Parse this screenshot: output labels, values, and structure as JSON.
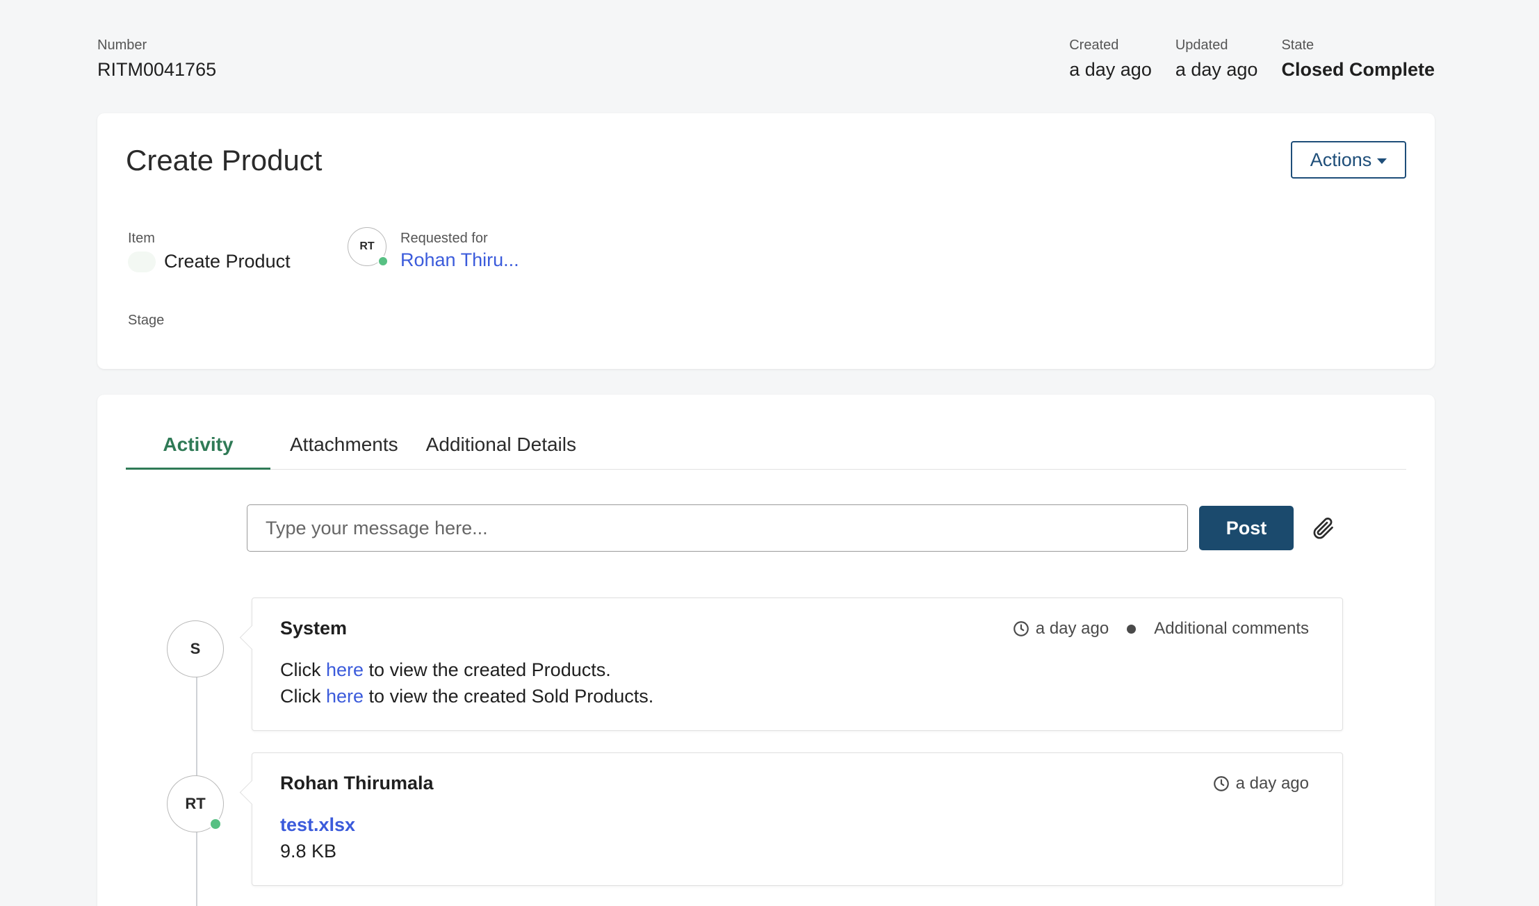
{
  "meta": {
    "number_label": "Number",
    "number_value": "RITM0041765",
    "created_label": "Created",
    "created_value": "a day ago",
    "updated_label": "Updated",
    "updated_value": "a day ago",
    "state_label": "State",
    "state_value": "Closed Complete"
  },
  "header": {
    "title": "Create Product",
    "actions_label": "Actions",
    "item_label": "Item",
    "item_value": "Create Product",
    "requested_for_label": "Requested for",
    "requested_for_initials": "RT",
    "requested_for_name": "Rohan Thiru...",
    "stage_label": "Stage"
  },
  "tabs": [
    {
      "label": "Activity",
      "active": true
    },
    {
      "label": "Attachments",
      "active": false
    },
    {
      "label": "Additional Details",
      "active": false
    }
  ],
  "composer": {
    "placeholder": "Type your message here...",
    "post_label": "Post"
  },
  "activity": [
    {
      "initials": "S",
      "author": "System",
      "time": "a day ago",
      "type": "Additional comments",
      "lines": [
        {
          "prefix": "Click ",
          "link": "here",
          "suffix": " to view the created Products."
        },
        {
          "prefix": "Click ",
          "link": "here",
          "suffix": " to view the created Sold Products."
        }
      ]
    },
    {
      "initials": "RT",
      "author": "Rohan Thirumala",
      "time": "a day ago",
      "file_name": "test.xlsx",
      "file_size": "9.8 KB"
    }
  ],
  "colors": {
    "accent_green": "#2f7a56",
    "primary_blue": "#1b4a6d",
    "link_blue": "#3b5bdb",
    "presence_green": "#57c083"
  },
  "icons": [
    "caret-down-icon",
    "paperclip-icon",
    "clock-icon",
    "bullet-icon"
  ]
}
